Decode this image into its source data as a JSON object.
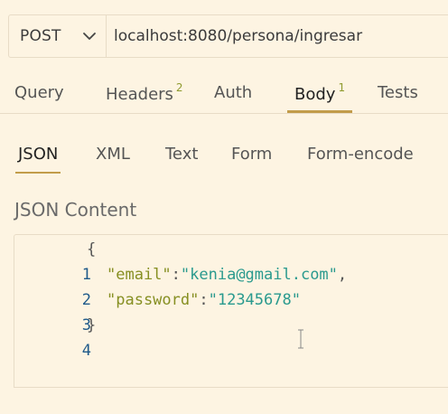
{
  "request": {
    "method": "POST",
    "url": "localhost:8080/persona/ingresar"
  },
  "request_tabs": [
    {
      "label": "Query",
      "badge": ""
    },
    {
      "label": "Headers",
      "badge": "2"
    },
    {
      "label": "Auth",
      "badge": ""
    },
    {
      "label": "Body",
      "badge": "1",
      "active": true
    },
    {
      "label": "Tests",
      "badge": ""
    }
  ],
  "body_tabs": [
    {
      "label": "JSON",
      "active": true
    },
    {
      "label": "XML"
    },
    {
      "label": "Text"
    },
    {
      "label": "Form"
    },
    {
      "label": "Form-encode"
    }
  ],
  "json_section": {
    "label": "JSON Content",
    "lines": [
      {
        "number": "1",
        "text": "{"
      },
      {
        "number": "2",
        "key": "\"email\"",
        "sep": ":",
        "value": "\"kenia@gmail.com\"",
        "tail": ","
      },
      {
        "number": "3",
        "key": "\"password\"",
        "sep": ":",
        "value": "\"12345678\"",
        "tail": ""
      },
      {
        "number": "4",
        "text": "}"
      }
    ]
  },
  "colors": {
    "background": "#fdf4e2",
    "active_tab_underline": "#c29c4a",
    "badge": "#8f9a2e",
    "json_key": "#868f22",
    "json_string": "#2a9a8e",
    "line_number": "#1f5a8a"
  },
  "icons": {
    "method_dropdown": "chevron-down-icon",
    "editor_cursor": "text-cursor-icon"
  }
}
